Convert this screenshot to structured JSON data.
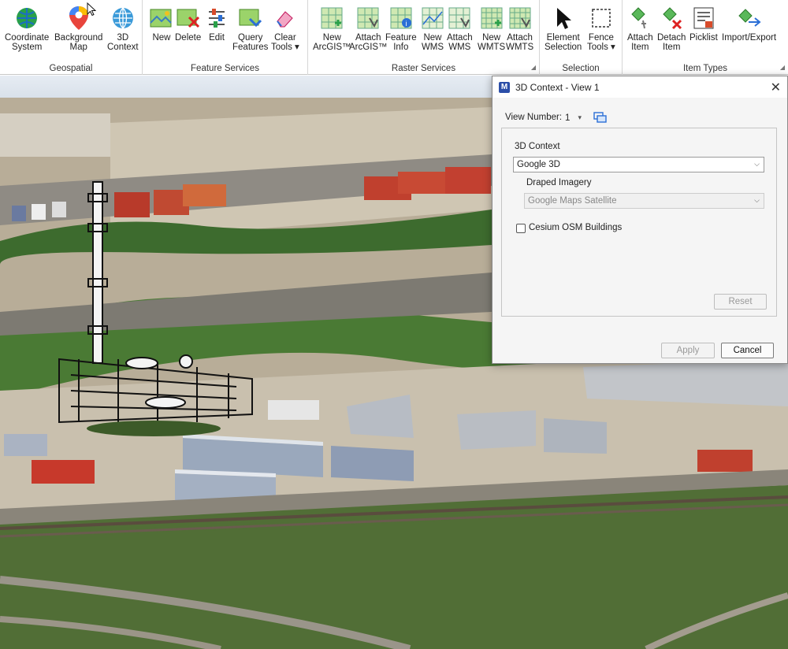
{
  "ribbon": {
    "groups": [
      {
        "title": "Geospatial",
        "buttons": [
          "Coordinate\nSystem",
          "Background\nMap",
          "3D\nContext"
        ]
      },
      {
        "title": "Feature Services",
        "buttons": [
          "New",
          "Delete",
          "Edit",
          "Query\nFeatures",
          "Clear\nTools ▾"
        ]
      },
      {
        "title": "Raster Services",
        "buttons": [
          "New\nArcGIS™",
          "Attach\nArcGIS™",
          "Feature\nInfo",
          "New\nWMS",
          "Attach\nWMS",
          "New\nWMTS",
          "Attach\nWMTS"
        ]
      },
      {
        "title": "Selection",
        "buttons": [
          "Element\nSelection",
          "Fence\nTools ▾"
        ]
      },
      {
        "title": "Item Types",
        "buttons": [
          "Attach\nItem",
          "Detach\nItem",
          "Picklist",
          "Import/Export"
        ]
      }
    ]
  },
  "dialog": {
    "title": "3D Context - View 1",
    "app_icon_letter": "M",
    "view_number_label": "View Number:",
    "view_number_value": "1",
    "context_label": "3D Context",
    "context_value": "Google 3D",
    "draped_label": "Draped Imagery",
    "draped_value": "Google Maps Satellite",
    "cesium_label": "Cesium OSM Buildings",
    "cesium_checked": false,
    "reset_label": "Reset",
    "apply_label": "Apply",
    "cancel_label": "Cancel"
  },
  "colors": {
    "accent": "#2b6fd6",
    "brand": "#2b4ea8"
  }
}
